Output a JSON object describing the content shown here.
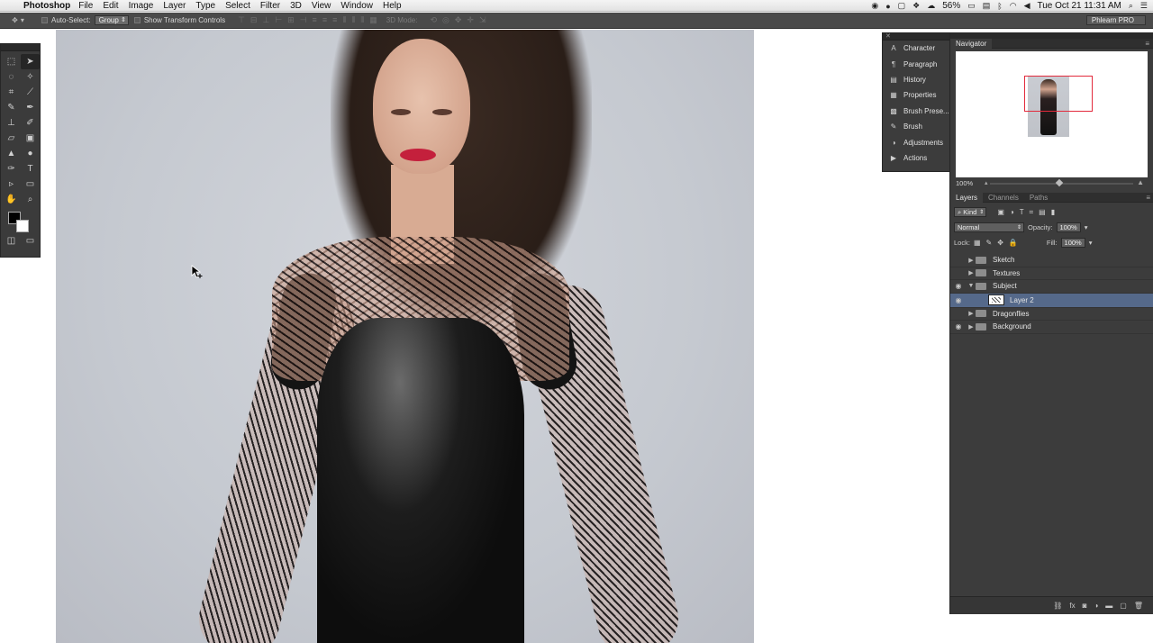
{
  "menubar": {
    "app_name": "Photoshop",
    "items": [
      "File",
      "Edit",
      "Image",
      "Layer",
      "Type",
      "Select",
      "Filter",
      "3D",
      "View",
      "Window",
      "Help"
    ],
    "battery": "56%",
    "clock": "Tue Oct 21  11:31 AM"
  },
  "optionsbar": {
    "auto_select_label": "Auto-Select:",
    "auto_select_value": "Group",
    "transform_label": "Show Transform Controls",
    "mode3d_label": "3D Mode:",
    "workspace": "Phlearn PRO"
  },
  "mini_dock": {
    "items": [
      {
        "label": "Character",
        "icon": "character-icon"
      },
      {
        "label": "Paragraph",
        "icon": "paragraph-icon"
      },
      {
        "label": "History",
        "icon": "history-icon"
      },
      {
        "label": "Properties",
        "icon": "properties-icon"
      },
      {
        "label": "Brush Prese...",
        "icon": "brush-presets-icon"
      },
      {
        "label": "Brush",
        "icon": "brush-icon"
      },
      {
        "label": "Adjustments",
        "icon": "adjustments-icon"
      },
      {
        "label": "Actions",
        "icon": "actions-icon"
      }
    ]
  },
  "navigator": {
    "tab": "Navigator",
    "zoom": "100%",
    "proxy_color": "#e22a3c"
  },
  "layers": {
    "tabs": [
      "Layers",
      "Channels",
      "Paths"
    ],
    "filter_kind": "Kind",
    "blend_mode": "Normal",
    "opacity_label": "Opacity:",
    "opacity_value": "100%",
    "lock_label": "Lock:",
    "fill_label": "Fill:",
    "fill_value": "100%",
    "list": [
      {
        "name": "Sketch",
        "type": "group",
        "visible": false
      },
      {
        "name": "Textures",
        "type": "group",
        "visible": false
      },
      {
        "name": "Subject",
        "type": "group",
        "visible": true,
        "expanded": true
      },
      {
        "name": "Layer 2",
        "type": "layer",
        "visible": true,
        "selected": true
      },
      {
        "name": "Dragonflies",
        "type": "group",
        "visible": false
      },
      {
        "name": "Background",
        "type": "group",
        "visible": true
      }
    ],
    "selection_color": "#55698a"
  }
}
